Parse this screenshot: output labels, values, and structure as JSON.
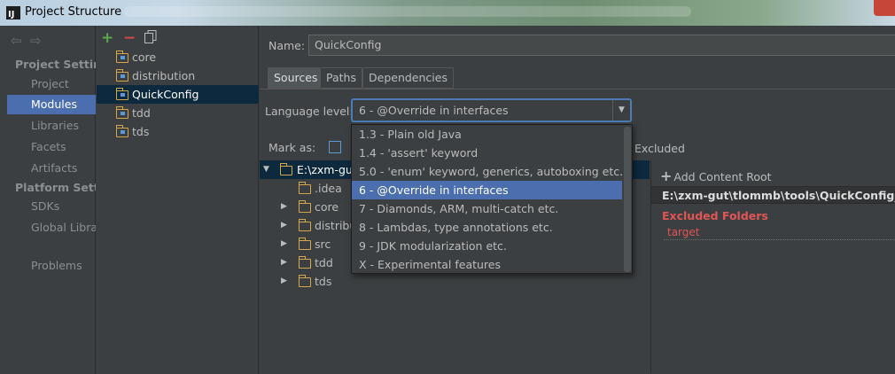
{
  "window": {
    "title": "Project Structure"
  },
  "nav": {
    "project_settings_header": "Project Settings",
    "project_items": [
      "Project",
      "Modules",
      "Libraries",
      "Facets",
      "Artifacts"
    ],
    "platform_settings_header": "Platform Settings",
    "platform_items": [
      "SDKs",
      "Global Libraries"
    ],
    "problems": "Problems",
    "selected": "Modules"
  },
  "modules": {
    "items": [
      "core",
      "distribution",
      "QuickConfig",
      "tdd",
      "tds"
    ],
    "selected": "QuickConfig"
  },
  "detail": {
    "name_label": "Name:",
    "name_value": "QuickConfig",
    "tabs": [
      "Sources",
      "Paths",
      "Dependencies"
    ],
    "active_tab": "Sources",
    "language_level_label": "Language level:",
    "language_level_value": "6 - @Override in interfaces",
    "mark_as_label": "Mark as:",
    "mark_excluded": "Excluded",
    "tree": {
      "root": "E:\\zxm-gut",
      "children": [
        ".idea",
        "core",
        "distribu",
        "src",
        "tdd",
        "tds"
      ]
    },
    "content_root": {
      "add_label": "Add Content Root",
      "path": "E:\\zxm-gut\\tlommb\\tools\\QuickConfig_too",
      "excluded_header": "Excluded Folders",
      "excluded_items": [
        "target"
      ]
    }
  },
  "language_dropdown": {
    "options": [
      "1.3 - Plain old Java",
      "1.4 - 'assert' keyword",
      "5.0 - 'enum' keyword, generics, autoboxing etc.",
      "6 - @Override in interfaces",
      "7 - Diamonds, ARM, multi-catch etc.",
      "8 - Lambdas, type annotations etc.",
      "9 - JDK modularization etc.",
      "X - Experimental features"
    ],
    "selected_index": 3
  },
  "colors": {
    "accent": "#4b6eaf",
    "error": "#e05555",
    "folder": "#d4a749",
    "add": "#5aa94a",
    "remove": "#d24b4b"
  },
  "icons": {
    "back": "back-arrow-icon",
    "forward": "forward-arrow-icon",
    "add": "plus-icon",
    "remove": "minus-icon",
    "copy": "copy-icon"
  }
}
